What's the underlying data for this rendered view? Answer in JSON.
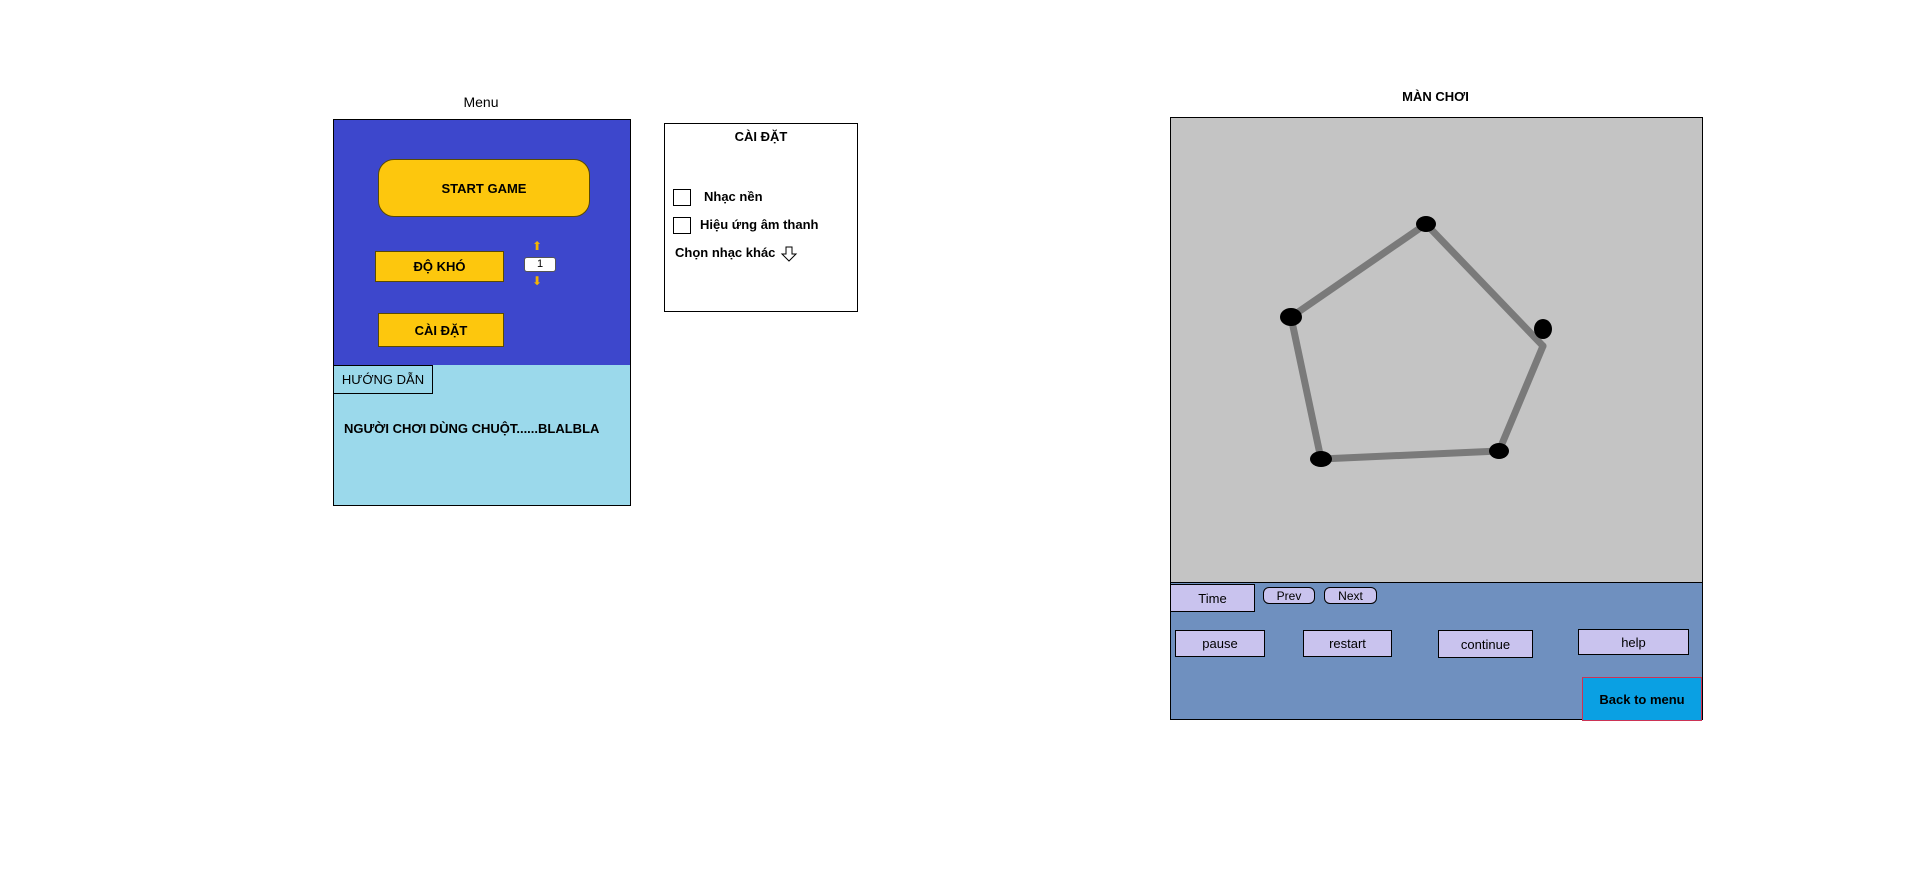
{
  "menu": {
    "caption": "Menu",
    "start_label": "START GAME",
    "difficulty_label": "ĐỘ KHÓ",
    "difficulty_value": "1",
    "settings_label": "CÀI ĐẶT",
    "guide_tab": "HƯỚNG DẪN",
    "guide_text": "NGƯỜI CHƠI DÙNG CHUỘT......BLALBLA"
  },
  "settings": {
    "title": "CÀI ĐẶT",
    "music_label": "Nhạc nền",
    "sfx_label": "Hiệu ứng âm thanh",
    "choose_music_label": "Chọn nhạc khác",
    "music_checked": false,
    "sfx_checked": false
  },
  "game": {
    "caption": "MÀN CHƠI",
    "time_label": "Time",
    "prev_label": "Prev",
    "next_label": "Next",
    "pause_label": "pause",
    "restart_label": "restart",
    "continue_label": "continue",
    "help_label": "help",
    "back_label": "Back to menu"
  },
  "colors": {
    "menu_bg": "#3d47cc",
    "guide_bg": "#9bd9eb",
    "button_yellow": "#fdc70d",
    "game_area_bg": "#c4c4c4",
    "control_bar_bg": "#6f90bf",
    "control_button": "#c9c3ee",
    "back_button": "#0aa0e3"
  }
}
